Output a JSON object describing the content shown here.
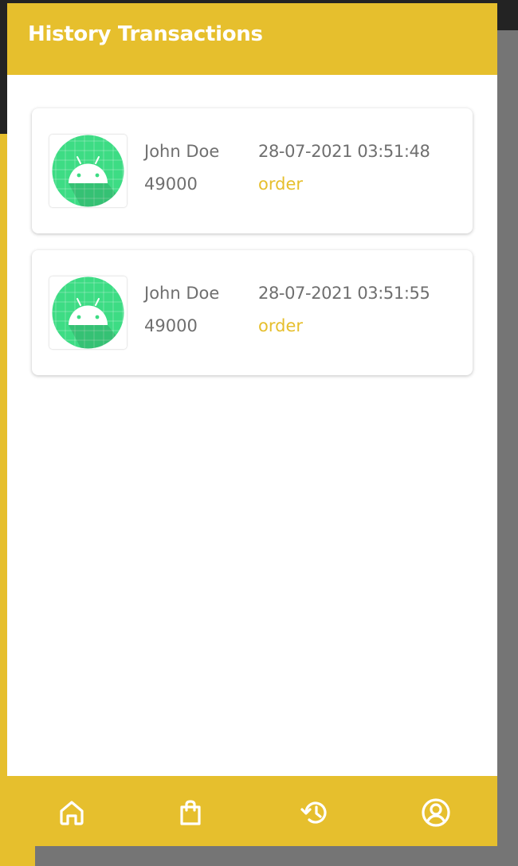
{
  "appbar": {
    "title": "History Transactions"
  },
  "transactions": [
    {
      "name": "John Doe",
      "amount": "49000",
      "date": "28-07-2021 03:51:48",
      "type": "order",
      "icon": "android-icon"
    },
    {
      "name": "John Doe",
      "amount": "49000",
      "date": "28-07-2021 03:51:55",
      "type": "order",
      "icon": "android-icon"
    }
  ],
  "bottom_nav": [
    {
      "icon": "home-icon"
    },
    {
      "icon": "shopping-bag-icon"
    },
    {
      "icon": "history-icon"
    },
    {
      "icon": "profile-icon"
    }
  ],
  "colors": {
    "accent": "#E6BF2D",
    "android_green": "#3DDC84",
    "text_gray": "#6f6f6f"
  }
}
